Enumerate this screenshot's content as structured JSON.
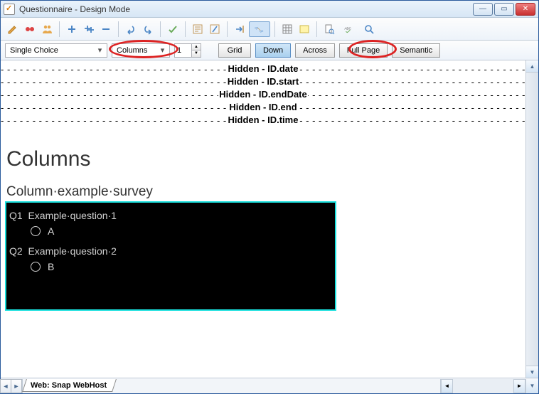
{
  "window": {
    "title": "Questionnaire - Design Mode"
  },
  "toolbar_icons": [
    "edit-mode-icon",
    "variables-icon",
    "users-icon",
    "sep",
    "add-icon",
    "add-multi-icon",
    "remove-icon",
    "sep",
    "undo-icon",
    "redo-icon",
    "sep",
    "check-icon",
    "sep",
    "properties-icon",
    "styles-icon",
    "sep",
    "goto-icon",
    "q1q2-icon",
    "sep",
    "grid-view-icon",
    "highlight-icon",
    "sep",
    "preview-icon",
    "spellcheck-icon",
    "search-icon"
  ],
  "controls": {
    "question_type": "Single Choice",
    "layout": "Columns",
    "columns": "1",
    "buttons": {
      "grid": "Grid",
      "down": "Down",
      "across": "Across",
      "fullpage": "Full Page",
      "semantic": "Semantic"
    },
    "active_button": "down"
  },
  "hidden_fields": [
    "Hidden - ID.date",
    "Hidden - ID.start",
    "Hidden - ID.endDate",
    "Hidden - ID.end",
    "Hidden - ID.time"
  ],
  "page": {
    "title": "Columns",
    "subtitle": "Column·example·survey"
  },
  "questions": [
    {
      "num": "Q1",
      "text": "Example·question·1",
      "option": "A"
    },
    {
      "num": "Q2",
      "text": "Example·question·2",
      "option": "B"
    }
  ],
  "tab_label": "Web: Snap WebHost",
  "annotations": {
    "circle_columns_combo": true,
    "circle_fullpage_button": true
  }
}
